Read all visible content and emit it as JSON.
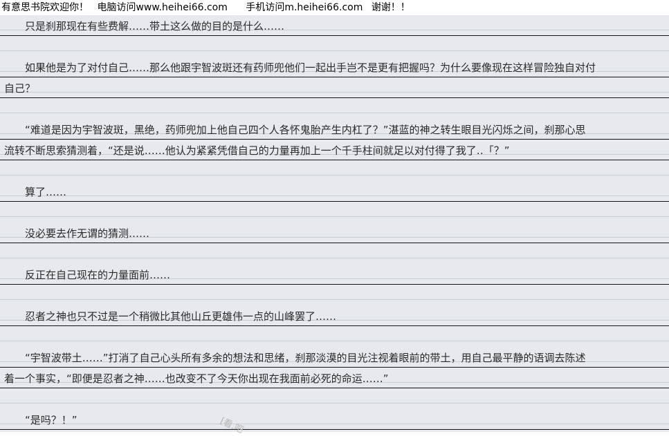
{
  "banner": {
    "welcome": "有意思书院欢迎你！",
    "pc_visit": "电脑访问www.heihei66.com",
    "mobile_visit": "手机访问m.heihei66.com",
    "thanks": "谢谢！！"
  },
  "paragraphs": [
    {
      "lines": [
        "只是刹那现在有些费解……带土这么做的目的是什么……"
      ]
    },
    {
      "lines": [
        "如果他是为了对付自己……那么他跟宇智波斑还有药师兜他们一起出手岂不是更有把握吗？为什么要像现在这样冒险独自对付",
        "自己？"
      ]
    },
    {
      "lines": [
        "“难道是因为宇智波斑，黑绝，药师兜加上他自己四个人各怀鬼胎产生内杠了？”湛蓝的神之转生眼目光闪烁之间，刹那心思",
        "流转不断思索猜测着，“还是说……他认为紧紧凭借自己的力量再加上一个千手柱间就足以对付得了我了‥「？”"
      ]
    },
    {
      "lines": [
        "算了……"
      ]
    },
    {
      "lines": [
        "没必要去作无谓的猜测……"
      ]
    },
    {
      "lines": [
        "反正在自己现在的力量面前……"
      ]
    },
    {
      "lines": [
        "忍者之神也只不过是一个稍微比其他山丘更雄伟一点的山峰罢了……"
      ]
    },
    {
      "lines": [
        "“宇智波带土……”打消了自己心头所有多余的想法和思绪，刹那淡漠的目光注视着眼前的带土，用自己最平静的语调去陈述",
        "着一个事实，“即便是忍者之神……也改变不了今天你出现在我面前必死的命运……”"
      ]
    },
    {
      "lines": [
        "“是吗？！”"
      ]
    }
  ],
  "watermark": "[看.吧",
  "colors": {
    "paper": "#e6e9ee",
    "rule_light": "#c8ccd3",
    "rule_dark": "#111111",
    "text": "#2a2a2a"
  }
}
